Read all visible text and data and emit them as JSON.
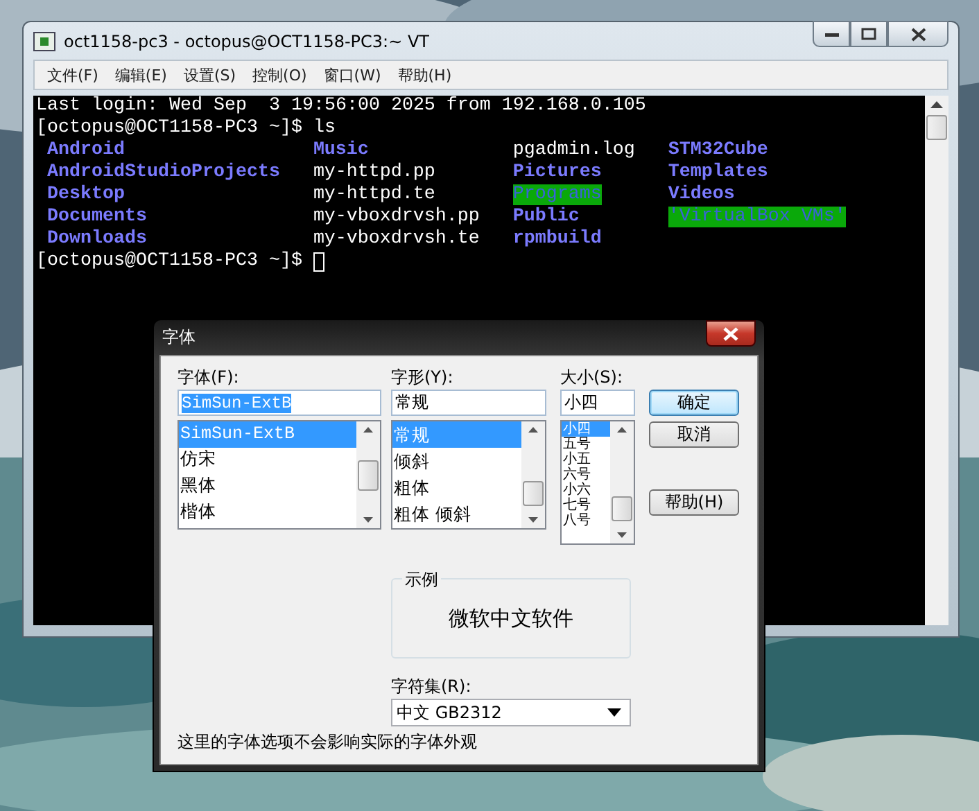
{
  "terminal_window": {
    "title": "oct1158-pc3 - octopus@OCT1158-PC3:~ VT",
    "menu": [
      "文件(F)",
      "编辑(E)",
      "设置(S)",
      "控制(O)",
      "窗口(W)",
      "帮助(H)"
    ],
    "lines": [
      "Last login: Wed Sep  3 19:56:00 2025 from 192.168.0.105",
      "[octopus@OCT1158-PC3 ~]$ ls"
    ],
    "listing": [
      {
        "name": "Android",
        "kind": "dir"
      },
      {
        "name": "Music",
        "kind": "dir"
      },
      {
        "name": "pgadmin.log",
        "kind": "file"
      },
      {
        "name": "STM32Cube",
        "kind": "dir"
      },
      {
        "name": "AndroidStudioProjects",
        "kind": "dir"
      },
      {
        "name": "my-httpd.pp",
        "kind": "file"
      },
      {
        "name": "Pictures",
        "kind": "dir"
      },
      {
        "name": "Templates",
        "kind": "dir"
      },
      {
        "name": "Desktop",
        "kind": "dir"
      },
      {
        "name": "my-httpd.te",
        "kind": "file"
      },
      {
        "name": "Programs",
        "kind": "writable"
      },
      {
        "name": "Videos",
        "kind": "dir"
      },
      {
        "name": "Documents",
        "kind": "dir"
      },
      {
        "name": "my-vboxdrvsh.pp",
        "kind": "file"
      },
      {
        "name": "Public",
        "kind": "dir"
      },
      {
        "name": "'VirtualBox VMs'",
        "kind": "writable"
      },
      {
        "name": "Downloads",
        "kind": "dir"
      },
      {
        "name": "my-vboxdrvsh.te",
        "kind": "file"
      },
      {
        "name": "rpmbuild",
        "kind": "dir"
      }
    ],
    "prompt": "[octopus@OCT1158-PC3 ~]$"
  },
  "font_dialog": {
    "title": "字体",
    "font": {
      "label": "字体(F):",
      "value": "SimSun-ExtB",
      "value_selected": true,
      "items": [
        {
          "text": "SimSun-ExtB",
          "selected": true
        },
        {
          "text": "仿宋",
          "selected": false
        },
        {
          "text": "黑体",
          "selected": false
        },
        {
          "text": "楷体",
          "selected": false
        }
      ]
    },
    "style": {
      "label": "字形(Y):",
      "value": "常规",
      "value_selected": false,
      "items": [
        {
          "text": "常规",
          "selected": true
        },
        {
          "text": "倾斜",
          "selected": false
        },
        {
          "text": "粗体",
          "selected": false
        },
        {
          "text": "粗体 倾斜",
          "selected": false
        }
      ]
    },
    "size": {
      "label": "大小(S):",
      "value": "小四",
      "value_selected": false,
      "items": [
        {
          "text": "小四",
          "selected": true
        },
        {
          "text": "五号",
          "selected": false
        },
        {
          "text": "小五",
          "selected": false
        },
        {
          "text": "六号",
          "selected": false
        },
        {
          "text": "小六",
          "selected": false
        },
        {
          "text": "七号",
          "selected": false
        },
        {
          "text": "八号",
          "selected": false
        }
      ]
    },
    "buttons": [
      {
        "label": "确定",
        "default": true
      },
      {
        "label": "取消",
        "default": false
      },
      {
        "label": "帮助(H)",
        "default": false
      }
    ],
    "sample": {
      "label": "示例",
      "text": "微软中文软件"
    },
    "charset": {
      "label": "字符集(R):",
      "value": "中文 GB2312"
    },
    "note": "这里的字体选项不会影响实际的字体外观"
  }
}
